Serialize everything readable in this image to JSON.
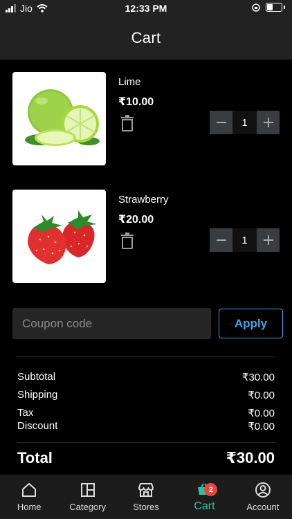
{
  "status": {
    "carrier": "Jio",
    "time": "12:33 PM"
  },
  "header": {
    "title": "Cart"
  },
  "items": [
    {
      "name": "Lime",
      "price": "₹10.00",
      "quantity": "1",
      "image_icon": "lime-image"
    },
    {
      "name": "Strawberry",
      "price": "₹20.00",
      "quantity": "1",
      "image_icon": "strawberry-image"
    }
  ],
  "coupon": {
    "placeholder": "Coupon code",
    "value": "",
    "apply_label": "Apply"
  },
  "summary": {
    "subtotal_label": "Subtotal",
    "subtotal_value": "₹30.00",
    "shipping_label": "Shipping",
    "shipping_value": "₹0.00",
    "tax_label": "Tax",
    "tax_value": "₹0.00",
    "discount_label": "Discount",
    "discount_value": "₹0.00",
    "total_label": "Total",
    "total_value": "₹30.00"
  },
  "tabs": [
    {
      "label": "Home",
      "icon": "home-icon"
    },
    {
      "label": "Category",
      "icon": "category-icon"
    },
    {
      "label": "Stores",
      "icon": "store-icon"
    },
    {
      "label": "Cart",
      "icon": "cart-icon",
      "badge": "2",
      "active": true
    },
    {
      "label": "Account",
      "icon": "account-icon"
    }
  ],
  "colors": {
    "accent": "#27c6a3",
    "link": "#3ea7e6",
    "badge": "#e8453c",
    "header_bg": "#222222"
  }
}
